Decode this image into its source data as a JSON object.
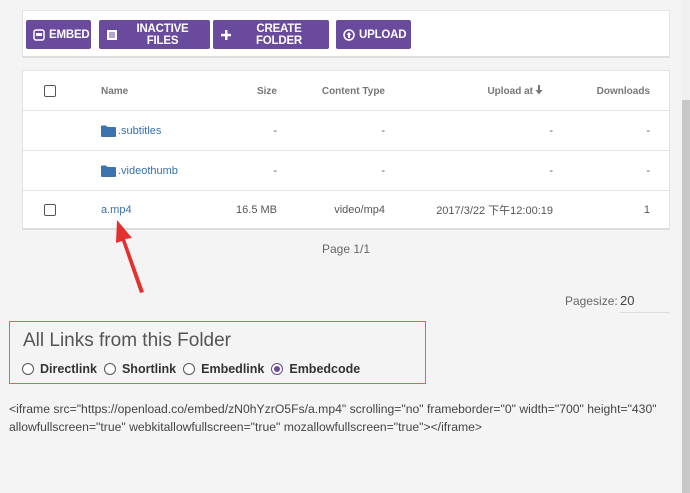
{
  "toolbar": {
    "buttons": [
      {
        "label": "EMBED",
        "icon": "embed-icon"
      },
      {
        "label": "INACTIVE FILES",
        "icon": "file-list-icon"
      },
      {
        "label": "CREATE FOLDER",
        "icon": "plus-icon"
      },
      {
        "label": "UPLOAD",
        "icon": "upload-icon"
      }
    ]
  },
  "table": {
    "headers": {
      "name": "Name",
      "size": "Size",
      "content_type": "Content Type",
      "upload_at": "Upload at",
      "downloads": "Downloads"
    },
    "rows": [
      {
        "type": "folder",
        "name": ".subtitles",
        "size": "-",
        "content_type": "-",
        "upload_at": "-",
        "downloads": "-"
      },
      {
        "type": "folder",
        "name": ".videothumb",
        "size": "-",
        "content_type": "-",
        "upload_at": "-",
        "downloads": "-"
      },
      {
        "type": "file",
        "name": "a.mp4",
        "size": "16.5 MB",
        "content_type": "video/mp4",
        "upload_at": "2017/3/22 下午12:00:19",
        "downloads": "1"
      }
    ]
  },
  "pagination": {
    "page_info": "Page 1/1",
    "pagesize_label": "Pagesize:",
    "pagesize_value": "20"
  },
  "links": {
    "title": "All Links from this Folder",
    "options": [
      {
        "label": "Directlink",
        "selected": false
      },
      {
        "label": "Shortlink",
        "selected": false
      },
      {
        "label": "Embedlink",
        "selected": false
      },
      {
        "label": "Embedcode",
        "selected": true
      }
    ],
    "code": "<iframe src=\"https://openload.co/embed/zN0hYzrO5Fs/a.mp4\" scrolling=\"no\" frameborder=\"0\" width=\"700\" height=\"430\" allowfullscreen=\"true\" webkitallowfullscreen=\"true\" mozallowfullscreen=\"true\"></iframe>"
  },
  "colors": {
    "accent": "#6a4a9c",
    "link": "#3a6fa8",
    "highlight_border": "#e06060",
    "annotation_arrow": "#e53030"
  }
}
